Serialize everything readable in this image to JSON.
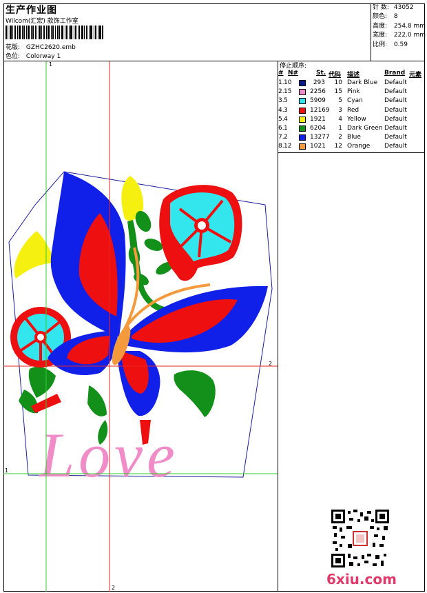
{
  "header": {
    "title": "生产作业图",
    "company": "Wilcom(汇宏) 款饰工作室",
    "design_label": "花版:",
    "design_value": "GZHC2620.emb",
    "colorway_label": "色位:",
    "colorway_value": "Colorway 1"
  },
  "stats": [
    {
      "label": "针 数:",
      "value": "43052"
    },
    {
      "label": "颜色:",
      "value": "8"
    },
    {
      "label": "高度:",
      "value": "254.8 mm"
    },
    {
      "label": "宽度:",
      "value": "222.0 mm"
    },
    {
      "label": "比例:",
      "value": "0.59"
    }
  ],
  "stop_sequence": {
    "title": "停止顺序:",
    "headers": {
      "num": "#",
      "n": "N#",
      "st": "St.",
      "code": "代码",
      "desc": "描述",
      "brand": "Brand",
      "element": "元素"
    },
    "rows": [
      {
        "idx": "1.",
        "n": "10",
        "color": "#0a1a8c",
        "st": "293",
        "code": "10",
        "desc": "Dark Blue",
        "brand": "Default"
      },
      {
        "idx": "2.",
        "n": "15",
        "color": "#f08cc8",
        "st": "2256",
        "code": "15",
        "desc": "Pink",
        "brand": "Default"
      },
      {
        "idx": "3.",
        "n": "5",
        "color": "#33e6ee",
        "st": "5909",
        "code": "5",
        "desc": "Cyan",
        "brand": "Default"
      },
      {
        "idx": "4.",
        "n": "3",
        "color": "#ee1010",
        "st": "12169",
        "code": "3",
        "desc": "Red",
        "brand": "Default"
      },
      {
        "idx": "5.",
        "n": "4",
        "color": "#f6f010",
        "st": "1921",
        "code": "4",
        "desc": "Yellow",
        "brand": "Default"
      },
      {
        "idx": "6.",
        "n": "1",
        "color": "#12901a",
        "st": "6204",
        "code": "1",
        "desc": "Dark Green",
        "brand": "Default"
      },
      {
        "idx": "7.",
        "n": "2",
        "color": "#1020e8",
        "st": "13277",
        "code": "2",
        "desc": "Blue",
        "brand": "Default"
      },
      {
        "idx": "8.",
        "n": "12",
        "color": "#f59a3c",
        "st": "1021",
        "code": "12",
        "desc": "Orange",
        "brand": "Default"
      }
    ]
  },
  "guides": {
    "v1": "1",
    "v2": "2",
    "h1": "1",
    "h2": "2"
  },
  "embroidery_text": "Love",
  "watermark": "6xiu.com",
  "colors": {
    "guide_green": "#33cc33",
    "guide_red": "#ee2222",
    "outline": "#1a1aa0"
  }
}
